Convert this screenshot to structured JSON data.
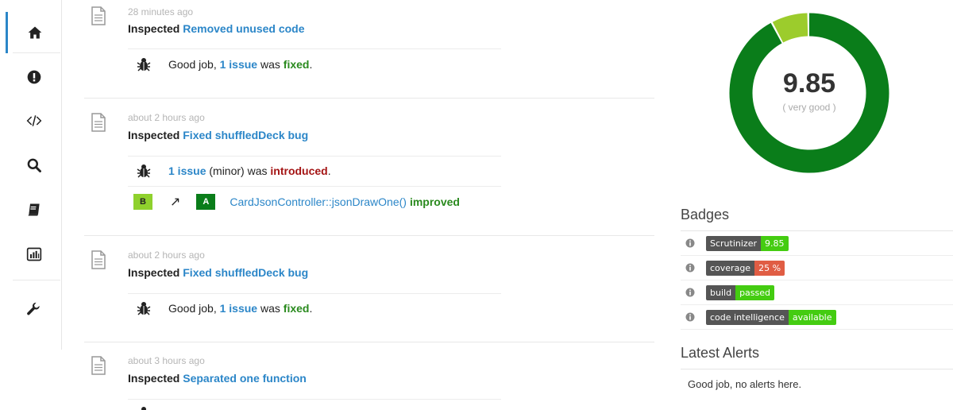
{
  "sidebar": {
    "items": [
      {
        "name": "home",
        "icon": "home-icon",
        "active": true
      },
      {
        "name": "issues",
        "icon": "exclamation-icon"
      },
      {
        "name": "code",
        "icon": "code-icon"
      },
      {
        "name": "search",
        "icon": "search-icon"
      },
      {
        "name": "book",
        "icon": "book-icon"
      },
      {
        "name": "stats",
        "icon": "bar-chart-icon"
      },
      {
        "name": "settings",
        "icon": "wrench-icon"
      }
    ]
  },
  "feed": {
    "entries": [
      {
        "time": "28 minutes ago",
        "inspected": "Inspected",
        "commit": "Removed unused code",
        "issue": {
          "prefix": "Good job, ",
          "count": "1 issue",
          "mid": " was ",
          "status": "fixed",
          "suffix": "."
        }
      },
      {
        "time": "about 2 hours ago",
        "inspected": "Inspected",
        "commit": "Fixed shuffledDeck bug",
        "issue": {
          "count": "1 issue",
          "mid": " (minor) was ",
          "status": "introduced",
          "suffix": "."
        },
        "grade": {
          "from": "B",
          "arrow": "↗",
          "to": "A",
          "method": "CardJsonController::jsonDrawOne()",
          "result": "improved"
        }
      },
      {
        "time": "about 2 hours ago",
        "inspected": "Inspected",
        "commit": "Fixed shuffledDeck bug",
        "issue": {
          "prefix": "Good job, ",
          "count": "1 issue",
          "mid": " was ",
          "status": "fixed",
          "suffix": "."
        }
      },
      {
        "time": "about 3 hours ago",
        "inspected": "Inspected",
        "commit": "Separated one function"
      }
    ]
  },
  "score": {
    "value": "9.85",
    "label": "( very good )",
    "fraction": 0.92,
    "colors": {
      "main": "#0a7d1a",
      "secondary": "#9ccc2c"
    }
  },
  "badges": {
    "title": "Badges",
    "items": [
      {
        "left": "Scrutinizer",
        "right": "9.85",
        "color": "#44cc11"
      },
      {
        "left": "coverage",
        "right": "25 %",
        "color": "#e05d44"
      },
      {
        "left": "build",
        "right": "passed",
        "color": "#44cc11"
      },
      {
        "left": "code intelligence",
        "right": "available",
        "color": "#44cc11"
      }
    ]
  },
  "alerts": {
    "title": "Latest Alerts",
    "text": "Good job, no alerts here."
  }
}
